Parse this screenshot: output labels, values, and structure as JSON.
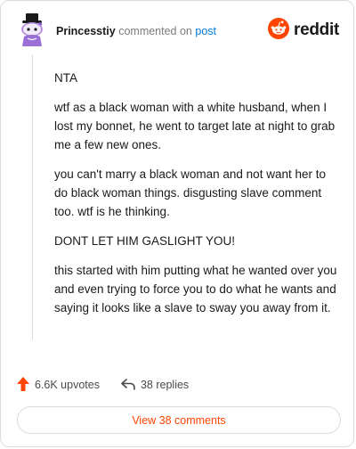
{
  "header": {
    "username": "Princesstiy",
    "commented_on": "commented on",
    "post_link": "post",
    "logo_text": "reddit",
    "logo_icon": "reddit-snoo-icon",
    "avatar_icon": "snoo-avatar-icon"
  },
  "comment": {
    "paragraphs": [
      "NTA",
      "wtf as a black woman with a white husband, when I lost my bonnet, he went to target late at night to grab me a few new ones.",
      "you can't marry a black woman and not want her to do black woman things. disgusting slave comment too. wtf is he thinking.",
      "DONT LET HIM GASLIGHT YOU!",
      "this started with him putting what he wanted over you and even trying to force you to do what he wants and saying it looks like a slave to sway you away from it."
    ]
  },
  "actions": {
    "upvotes_label": "6.6K upvotes",
    "replies_label": "38 replies",
    "upvote_icon": "upvote-arrow-icon",
    "reply_icon": "reply-arrow-icon"
  },
  "footer": {
    "view_comments_label": "View 38 comments"
  },
  "colors": {
    "brand": "#ff4500",
    "link": "#0079d3",
    "text": "#1a1a1b",
    "muted": "#7c7c7c",
    "border": "#d9dde0"
  }
}
